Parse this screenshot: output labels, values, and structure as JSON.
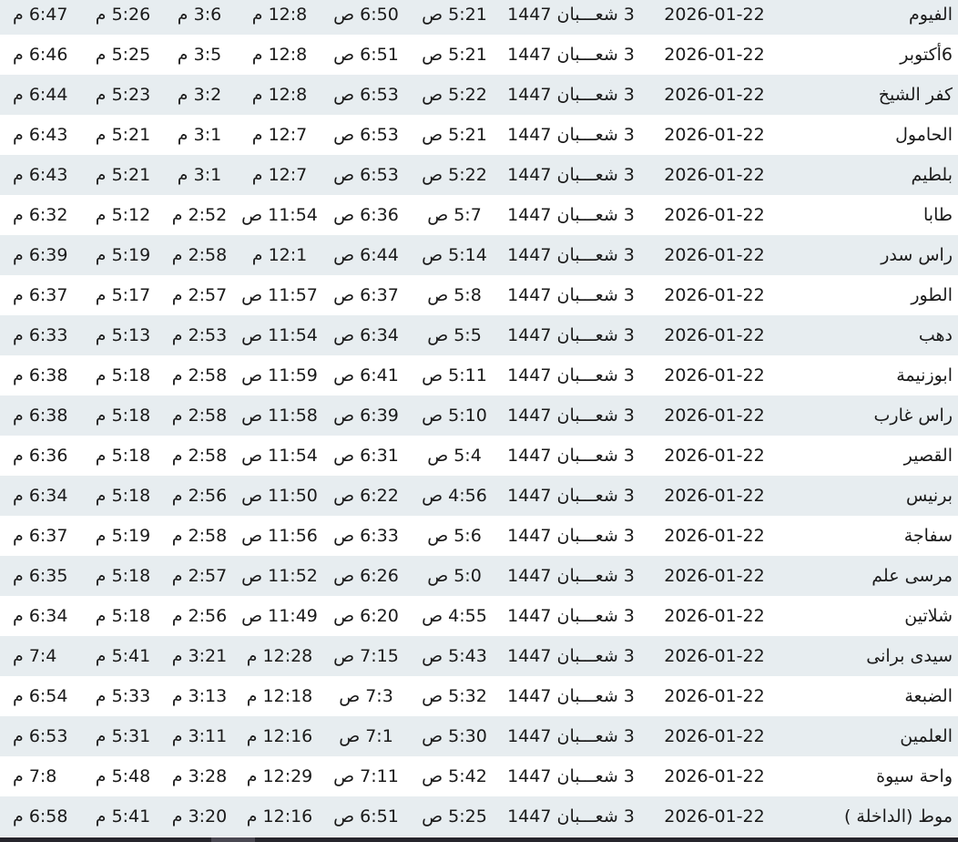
{
  "rows": [
    {
      "city": "الفيوم",
      "date": "2026-01-22",
      "hijri": "3 شعـــبان 1447",
      "fajr": "5:21 ص",
      "sunrise": "6:50 ص",
      "dhuhr": "12:8 م",
      "asr": "3:6 م",
      "maghrib": "5:26 م",
      "isha": "6:47 م"
    },
    {
      "city": "6أكتوبر",
      "date": "2026-01-22",
      "hijri": "3 شعـــبان 1447",
      "fajr": "5:21 ص",
      "sunrise": "6:51 ص",
      "dhuhr": "12:8 م",
      "asr": "3:5 م",
      "maghrib": "5:25 م",
      "isha": "6:46 م"
    },
    {
      "city": "كفر الشيخ",
      "date": "2026-01-22",
      "hijri": "3 شعـــبان 1447",
      "fajr": "5:22 ص",
      "sunrise": "6:53 ص",
      "dhuhr": "12:8 م",
      "asr": "3:2 م",
      "maghrib": "5:23 م",
      "isha": "6:44 م"
    },
    {
      "city": "الحامول",
      "date": "2026-01-22",
      "hijri": "3 شعـــبان 1447",
      "fajr": "5:21 ص",
      "sunrise": "6:53 ص",
      "dhuhr": "12:7 م",
      "asr": "3:1 م",
      "maghrib": "5:21 م",
      "isha": "6:43 م"
    },
    {
      "city": "بلطيم",
      "date": "2026-01-22",
      "hijri": "3 شعـــبان 1447",
      "fajr": "5:22 ص",
      "sunrise": "6:53 ص",
      "dhuhr": "12:7 م",
      "asr": "3:1 م",
      "maghrib": "5:21 م",
      "isha": "6:43 م"
    },
    {
      "city": "طابا",
      "date": "2026-01-22",
      "hijri": "3 شعـــبان 1447",
      "fajr": "5:7 ص",
      "sunrise": "6:36 ص",
      "dhuhr": "11:54 ص",
      "asr": "2:52 م",
      "maghrib": "5:12 م",
      "isha": "6:32 م"
    },
    {
      "city": "راس سدر",
      "date": "2026-01-22",
      "hijri": "3 شعـــبان 1447",
      "fajr": "5:14 ص",
      "sunrise": "6:44 ص",
      "dhuhr": "12:1 م",
      "asr": "2:58 م",
      "maghrib": "5:19 م",
      "isha": "6:39 م"
    },
    {
      "city": "الطور",
      "date": "2026-01-22",
      "hijri": "3 شعـــبان 1447",
      "fajr": "5:8 ص",
      "sunrise": "6:37 ص",
      "dhuhr": "11:57 ص",
      "asr": "2:57 م",
      "maghrib": "5:17 م",
      "isha": "6:37 م"
    },
    {
      "city": "دهب",
      "date": "2026-01-22",
      "hijri": "3 شعـــبان 1447",
      "fajr": "5:5 ص",
      "sunrise": "6:34 ص",
      "dhuhr": "11:54 ص",
      "asr": "2:53 م",
      "maghrib": "5:13 م",
      "isha": "6:33 م"
    },
    {
      "city": "ابوزنيمة",
      "date": "2026-01-22",
      "hijri": "3 شعـــبان 1447",
      "fajr": "5:11 ص",
      "sunrise": "6:41 ص",
      "dhuhr": "11:59 ص",
      "asr": "2:58 م",
      "maghrib": "5:18 م",
      "isha": "6:38 م"
    },
    {
      "city": "راس غارب",
      "date": "2026-01-22",
      "hijri": "3 شعـــبان 1447",
      "fajr": "5:10 ص",
      "sunrise": "6:39 ص",
      "dhuhr": "11:58 ص",
      "asr": "2:58 م",
      "maghrib": "5:18 م",
      "isha": "6:38 م"
    },
    {
      "city": "القصير",
      "date": "2026-01-22",
      "hijri": "3 شعـــبان 1447",
      "fajr": "5:4 ص",
      "sunrise": "6:31 ص",
      "dhuhr": "11:54 ص",
      "asr": "2:58 م",
      "maghrib": "5:18 م",
      "isha": "6:36 م"
    },
    {
      "city": "برنيس",
      "date": "2026-01-22",
      "hijri": "3 شعـــبان 1447",
      "fajr": "4:56 ص",
      "sunrise": "6:22 ص",
      "dhuhr": "11:50 ص",
      "asr": "2:56 م",
      "maghrib": "5:18 م",
      "isha": "6:34 م"
    },
    {
      "city": "سفاجة",
      "date": "2026-01-22",
      "hijri": "3 شعـــبان 1447",
      "fajr": "5:6 ص",
      "sunrise": "6:33 ص",
      "dhuhr": "11:56 ص",
      "asr": "2:58 م",
      "maghrib": "5:19 م",
      "isha": "6:37 م"
    },
    {
      "city": "مرسى علم",
      "date": "2026-01-22",
      "hijri": "3 شعـــبان 1447",
      "fajr": "5:0 ص",
      "sunrise": "6:26 ص",
      "dhuhr": "11:52 ص",
      "asr": "2:57 م",
      "maghrib": "5:18 م",
      "isha": "6:35 م"
    },
    {
      "city": "شلاتين",
      "date": "2026-01-22",
      "hijri": "3 شعـــبان 1447",
      "fajr": "4:55 ص",
      "sunrise": "6:20 ص",
      "dhuhr": "11:49 ص",
      "asr": "2:56 م",
      "maghrib": "5:18 م",
      "isha": "6:34 م"
    },
    {
      "city": "سيدى برانى",
      "date": "2026-01-22",
      "hijri": "3 شعـــبان 1447",
      "fajr": "5:43 ص",
      "sunrise": "7:15 ص",
      "dhuhr": "12:28 م",
      "asr": "3:21 م",
      "maghrib": "5:41 م",
      "isha": "7:4 م"
    },
    {
      "city": "الضبعة",
      "date": "2026-01-22",
      "hijri": "3 شعـــبان 1447",
      "fajr": "5:32 ص",
      "sunrise": "7:3 ص",
      "dhuhr": "12:18 م",
      "asr": "3:13 م",
      "maghrib": "5:33 م",
      "isha": "6:54 م"
    },
    {
      "city": "العلمين",
      "date": "2026-01-22",
      "hijri": "3 شعـــبان 1447",
      "fajr": "5:30 ص",
      "sunrise": "7:1 ص",
      "dhuhr": "12:16 م",
      "asr": "3:11 م",
      "maghrib": "5:31 م",
      "isha": "6:53 م"
    },
    {
      "city": "واحة سيوة",
      "date": "2026-01-22",
      "hijri": "3 شعـــبان 1447",
      "fajr": "5:42 ص",
      "sunrise": "7:11 ص",
      "dhuhr": "12:29 م",
      "asr": "3:28 م",
      "maghrib": "5:48 م",
      "isha": "7:8 م"
    },
    {
      "city": "موط (الداخلة )",
      "date": "2026-01-22",
      "hijri": "3 شعـــبان 1447",
      "fajr": "5:25 ص",
      "sunrise": "6:51 ص",
      "dhuhr": "12:16 م",
      "asr": "3:20 م",
      "maghrib": "5:41 م",
      "isha": "6:58 م"
    }
  ],
  "colors": {
    "row_stripe": "#e7edf0",
    "row_plain": "#ffffff",
    "text": "#1a1a1a",
    "bottom_bar": "#26252c"
  }
}
